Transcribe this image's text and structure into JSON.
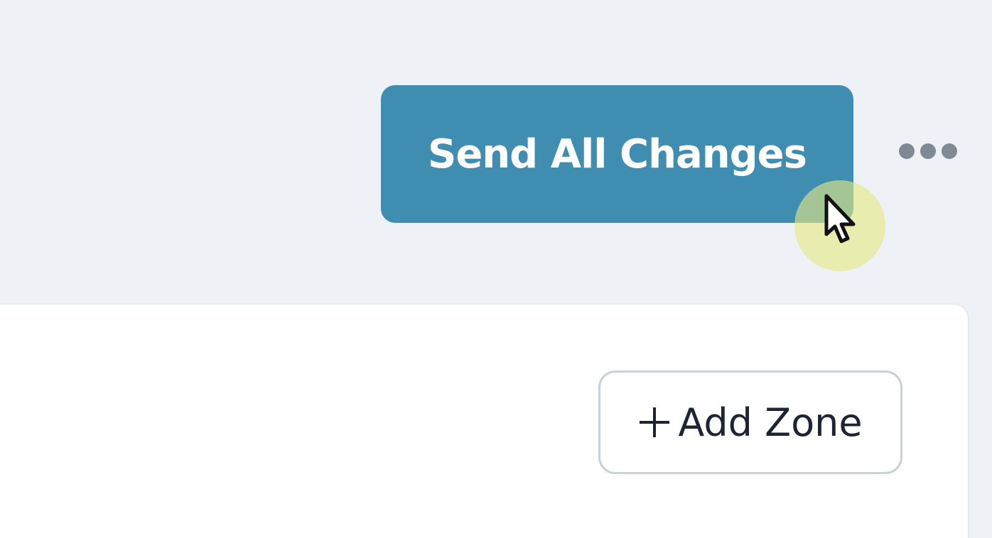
{
  "toolbar": {
    "send_all_label": "Send All Changes",
    "more_icon": "more-horizontal-icon"
  },
  "zone_panel": {
    "add_zone_label": "Add Zone",
    "add_icon": "plus-icon"
  },
  "colors": {
    "page_background": "#eef1f6",
    "primary_button": "#3f8db0",
    "panel_background": "#ffffff",
    "outline_border": "#c9d2d7",
    "cursor_highlight": "#e5e982"
  },
  "cursor": {
    "icon": "mouse-pointer-icon"
  }
}
